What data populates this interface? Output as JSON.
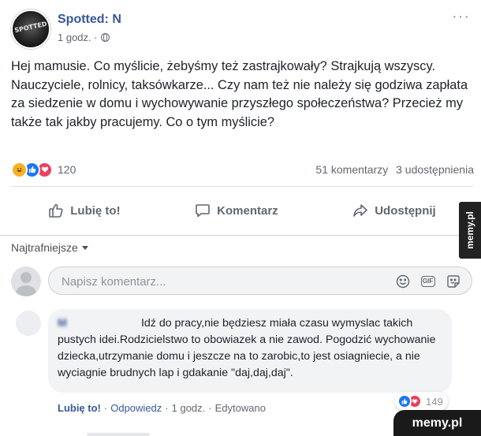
{
  "post": {
    "page_name": "Spotted: N",
    "time": "1 godz. ·",
    "avatar_text": "SPOTTED",
    "more": "···",
    "text": "Hej mamusie. Co myślicie, żebyśmy też zastrajkowały? Strajkują wszyscy. Nauczyciele, rolnicy, taksówkarze... Czy nam też nie należy się godziwa zapłata za siedzenie w domu i wychowywanie przyszłego społeczeństwa? Przecież my także tak jakby pracujemy. Co o tym myślicie?",
    "reaction_count": "120",
    "comments_count": "51 komentarzy",
    "shares_count": "3 udostępnienia"
  },
  "actions": {
    "like": "Lubię to!",
    "comment": "Komentarz",
    "share": "Udostępnij"
  },
  "comments": {
    "sort_label": "Najtrafniejsze",
    "input_placeholder": "Napisz komentarz...",
    "gif_label": "GIF",
    "items": [
      {
        "author": "M",
        "text": "Idź do pracy,nie będziesz miała czasu wymyslac takich pustych idei.Rodzicielstwo to obowiazek a nie zawod. Pogodzić wychowanie dziecka,utrzymanie domu i jeszcze na to zarobic,to jest osiagniecie, a nie wyciagnie brudnych lap i gdakanie \"daj,daj,daj\".",
        "reaction_count": "149",
        "like_label": "Lubię to!",
        "separator": "·",
        "reply_label": "Odpowiedz",
        "time": "1 godz.",
        "edited": "Edytowano"
      }
    ]
  },
  "watermark": {
    "side": "memy.pl",
    "corner": "memy.pl"
  },
  "colors": {
    "link": "#365899",
    "secondary_text": "#606770",
    "like_blue": "#1877f2",
    "love_red": "#e9405b",
    "haha_yellow": "#f7b125"
  }
}
